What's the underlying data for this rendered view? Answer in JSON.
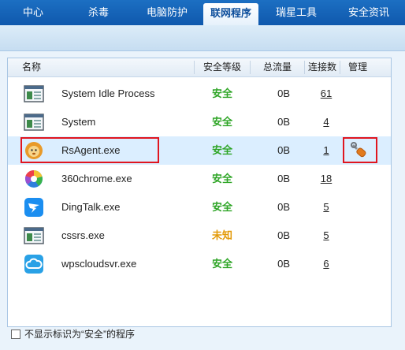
{
  "tabs": [
    {
      "label": "中心"
    },
    {
      "label": "杀毒"
    },
    {
      "label": "电脑防护"
    },
    {
      "label": "联网程序",
      "active": true
    },
    {
      "label": "瑞星工具"
    },
    {
      "label": "安全资讯"
    }
  ],
  "table": {
    "columns": {
      "name": "名称",
      "level": "安全等级",
      "traffic": "总流量",
      "connections": "连接数",
      "manage": "管理"
    },
    "rows": [
      {
        "name": "System Idle Process",
        "level": "安全",
        "level_status": "safe",
        "traffic": "0B",
        "connections": "61",
        "icon": "window-app-icon"
      },
      {
        "name": "System",
        "level": "安全",
        "level_status": "safe",
        "traffic": "0B",
        "connections": "4",
        "icon": "window-app-icon"
      },
      {
        "name": "RsAgent.exe",
        "level": "安全",
        "level_status": "safe",
        "traffic": "0B",
        "connections": "1",
        "icon": "lion-icon",
        "selected": true,
        "manage_icon": "wrench-icon"
      },
      {
        "name": "360chrome.exe",
        "level": "安全",
        "level_status": "safe",
        "traffic": "0B",
        "connections": "18",
        "icon": "360-browser-icon"
      },
      {
        "name": "DingTalk.exe",
        "level": "安全",
        "level_status": "safe",
        "traffic": "0B",
        "connections": "5",
        "icon": "dingtalk-icon"
      },
      {
        "name": "cssrs.exe",
        "level": "未知",
        "level_status": "unknown",
        "traffic": "0B",
        "connections": "5",
        "icon": "window-app-icon"
      },
      {
        "name": "wpscloudsvr.exe",
        "level": "安全",
        "level_status": "safe",
        "traffic": "0B",
        "connections": "6",
        "icon": "cloud-icon"
      }
    ]
  },
  "footer": {
    "checkbox_label": "不显示标识为“安全”的程序"
  },
  "colors": {
    "nav_blue": "#1565c0",
    "safe_green": "#2ea526",
    "unknown_orange": "#e39a09",
    "highlight_red": "#e0151f"
  }
}
